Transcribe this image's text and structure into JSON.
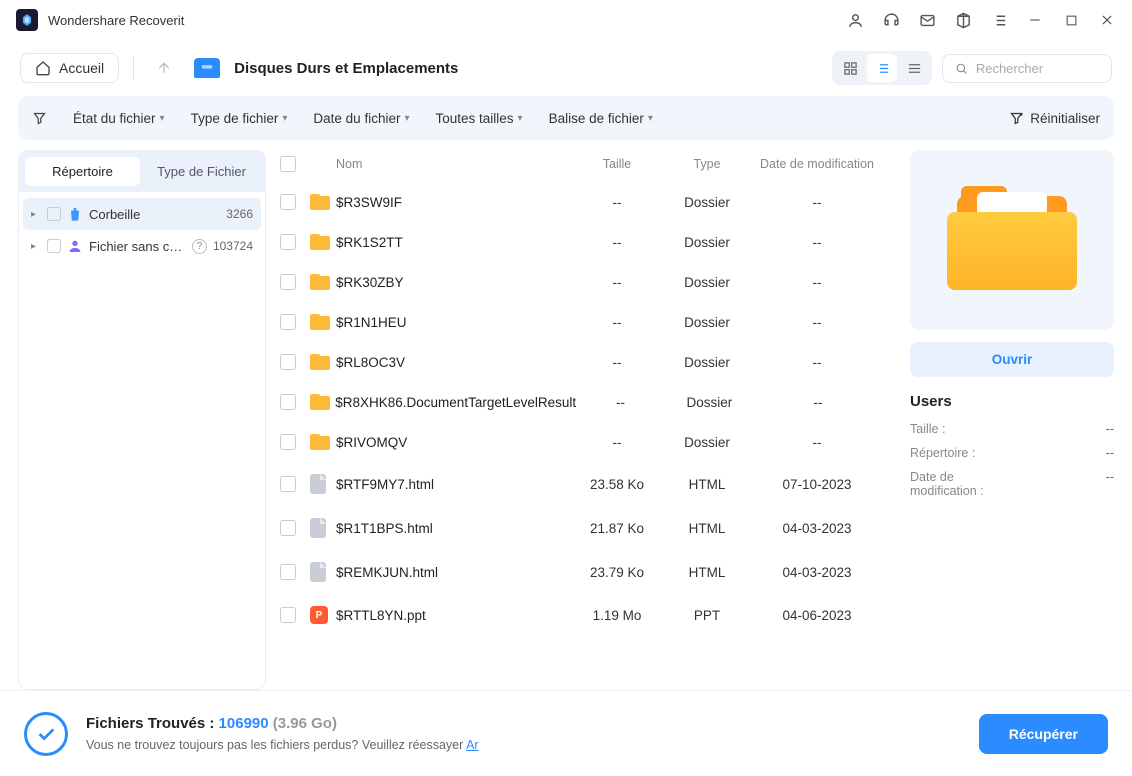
{
  "app": {
    "title": "Wondershare Recoverit"
  },
  "toolbar": {
    "home": "Accueil",
    "breadcrumb": "Disques Durs et Emplacements",
    "search_placeholder": "Rechercher"
  },
  "filters": {
    "state": "État du fichier",
    "type": "Type de fichier",
    "date": "Date du fichier",
    "size": "Toutes tailles",
    "tag": "Balise de fichier",
    "reset": "Réinitialiser"
  },
  "sidebar": {
    "tab_directory": "Répertoire",
    "tab_filetype": "Type de Fichier",
    "items": [
      {
        "label": "Corbeille",
        "count": "3266",
        "icon": "trash",
        "selected": true
      },
      {
        "label": "Fichier sans che...",
        "count": "103724",
        "icon": "user",
        "help": true
      }
    ]
  },
  "columns": {
    "name": "Nom",
    "size": "Taille",
    "type": "Type",
    "date": "Date de modification"
  },
  "files": [
    {
      "name": "$R3SW9IF",
      "size": "--",
      "type": "Dossier",
      "date": "--",
      "kind": "folder"
    },
    {
      "name": "$RK1S2TT",
      "size": "--",
      "type": "Dossier",
      "date": "--",
      "kind": "folder"
    },
    {
      "name": "$RK30ZBY",
      "size": "--",
      "type": "Dossier",
      "date": "--",
      "kind": "folder"
    },
    {
      "name": "$R1N1HEU",
      "size": "--",
      "type": "Dossier",
      "date": "--",
      "kind": "folder"
    },
    {
      "name": "$RL8OC3V",
      "size": "--",
      "type": "Dossier",
      "date": "--",
      "kind": "folder"
    },
    {
      "name": "$R8XHK86.DocumentTargetLevelResult",
      "size": "--",
      "type": "Dossier",
      "date": "--",
      "kind": "folder"
    },
    {
      "name": "$RIVOMQV",
      "size": "--",
      "type": "Dossier",
      "date": "--",
      "kind": "folder"
    },
    {
      "name": "$RTF9MY7.html",
      "size": "23.58 Ko",
      "type": "HTML",
      "date": "07-10-2023",
      "kind": "file"
    },
    {
      "name": "$R1T1BPS.html",
      "size": "21.87 Ko",
      "type": "HTML",
      "date": "04-03-2023",
      "kind": "file"
    },
    {
      "name": "$REMKJUN.html",
      "size": "23.79 Ko",
      "type": "HTML",
      "date": "04-03-2023",
      "kind": "file"
    },
    {
      "name": "$RTTL8YN.ppt",
      "size": "1.19 Mo",
      "type": "PPT",
      "date": "04-06-2023",
      "kind": "ppt"
    }
  ],
  "preview": {
    "open": "Ouvrir",
    "title": "Users",
    "meta": {
      "size_label": "Taille :",
      "size_val": "--",
      "dir_label": "Répertoire :",
      "dir_val": "--",
      "date_label": "Date de modification :",
      "date_val": "--"
    }
  },
  "footer": {
    "found_label": "Fichiers Trouvés : ",
    "found_count": "106990",
    "found_size": " (3.96 Go)",
    "hint": "Vous ne trouvez toujours pas les fichiers perdus? Veuillez réessayer ",
    "hint_link": "Ar",
    "recover": "Récupérer"
  }
}
